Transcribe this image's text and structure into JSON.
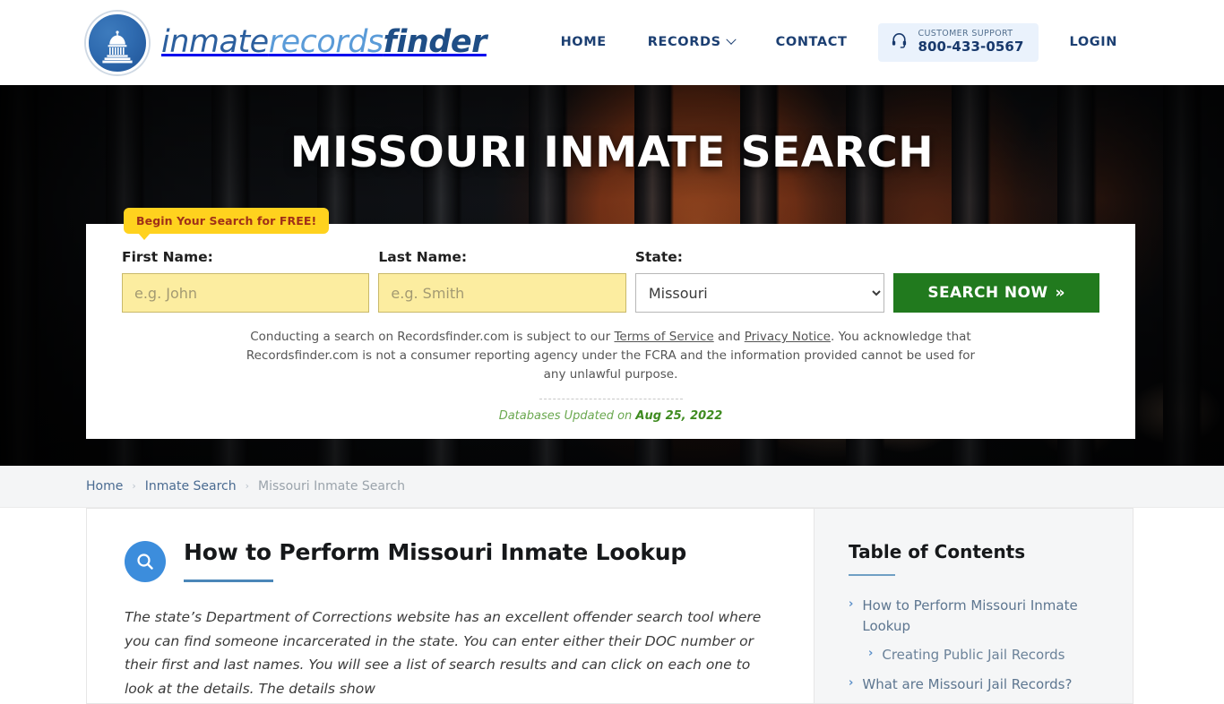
{
  "header": {
    "logo": {
      "part1": "inmate",
      "part2": "records",
      "part3": "finder"
    },
    "nav": [
      {
        "label": "HOME"
      },
      {
        "label": "RECORDS"
      },
      {
        "label": "CONTACT"
      },
      {
        "label": "LOGIN"
      }
    ],
    "support": {
      "label": "CUSTOMER SUPPORT",
      "phone": "800-433-0567"
    }
  },
  "hero": {
    "title": "MISSOURI INMATE SEARCH",
    "badge": "Begin Your Search for FREE!",
    "form": {
      "first_name_label": "First Name:",
      "first_name_placeholder": "e.g. John",
      "first_name_value": "",
      "last_name_label": "Last Name:",
      "last_name_placeholder": "e.g. Smith",
      "last_name_value": "",
      "state_label": "State:",
      "state_value": "Missouri",
      "state_options": [
        "Missouri"
      ],
      "submit_label": "SEARCH NOW",
      "submit_chevron": "»"
    },
    "disclaimer": {
      "text_before": "Conducting a search on Recordsfinder.com is subject to our ",
      "link_tos": "Terms of Service",
      "text_mid": " and ",
      "link_privacy": "Privacy Notice",
      "text_after": ". You acknowledge that Recordsfinder.com is not a consumer reporting agency under the FCRA and the information provided cannot be used for any unlawful purpose."
    },
    "updated_prefix": "Databases Updated on",
    "updated_date": "Aug 25, 2022"
  },
  "breadcrumb": {
    "items": [
      {
        "label": "Home",
        "current": false
      },
      {
        "label": "Inmate Search",
        "current": false
      },
      {
        "label": "Missouri Inmate Search",
        "current": true
      }
    ],
    "separator": "›"
  },
  "article": {
    "title": "How to Perform Missouri Inmate Lookup",
    "paragraph": "The state’s Department of Corrections website has an excellent offender search tool where you can find someone incarcerated in the state. You can enter either their DOC number or their first and last names. You will see a list of search results and can click on each one to look at the details. The details show"
  },
  "sidebar": {
    "toc_title": "Table of Contents",
    "toc": [
      {
        "label": "How to Perform Missouri Inmate Lookup",
        "sub": false
      },
      {
        "label": "Creating Public Jail Records",
        "sub": true
      },
      {
        "label": "What are Missouri Jail Records?",
        "sub": false
      }
    ],
    "arrow": "›"
  },
  "colors": {
    "brand_dark": "#1f4e86",
    "brand_light": "#5a9bd8",
    "accent_green": "#217a1e",
    "accent_yellow": "#ffd21e",
    "input_yellow": "#fceda0",
    "updated_green": "#6aa84f"
  }
}
